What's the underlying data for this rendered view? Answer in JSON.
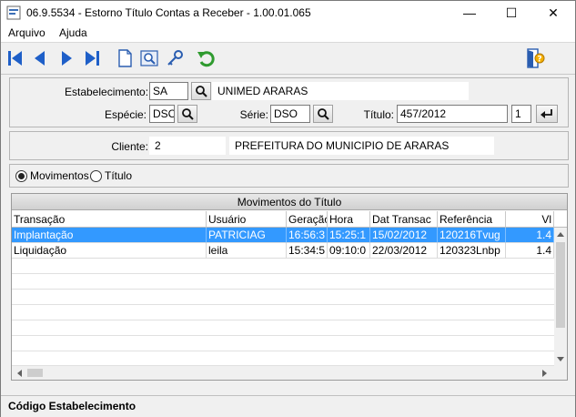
{
  "window": {
    "title": "06.9.5534 - Estorno Título Contas a Receber - 1.00.01.065",
    "minimize": "—",
    "maximize": "☐",
    "close": "✕"
  },
  "menu": [
    "Arquivo",
    "Ajuda"
  ],
  "toolbar": {
    "icons": [
      "first-record-icon",
      "previous-record-icon",
      "next-record-icon",
      "last-record-icon",
      "new-document-icon",
      "search-icon",
      "key-icon",
      "undo-icon",
      "exit-icon"
    ]
  },
  "form": {
    "estabelecimento_label": "Estabelecimento:",
    "estabelecimento_code": "SA",
    "estabelecimento_name": "UNIMED ARARAS",
    "especie_label": "Espécie:",
    "especie_value": "DSC",
    "serie_label": "Série:",
    "serie_value": "DSO",
    "titulo_label": "Título:",
    "titulo_value": "457/2012",
    "parcela_value": "1",
    "cliente_label": "Cliente:",
    "cliente_code": "2",
    "cliente_name": "PREFEITURA DO MUNICIPIO DE ARARAS"
  },
  "view_options": {
    "movimentos_label": "Movimentos",
    "titulo_label": "Título",
    "selected": "Movimentos"
  },
  "grid": {
    "caption": "Movimentos do Título",
    "columns": [
      "Transação",
      "Usuário",
      "Geração",
      "Hora",
      "Dat Transac",
      "Referência",
      "Vl"
    ],
    "rows": [
      [
        "Implantação",
        "PATRICIAG",
        "16:56:3",
        "15:25:1",
        "15/02/2012",
        "120216Tvug",
        "1.4"
      ],
      [
        "Liquidação",
        "leila",
        "15:34:5",
        "09:10:0",
        "22/03/2012",
        "120323Lnbp",
        "1.4"
      ]
    ],
    "selected_row": 0
  },
  "status_bar": {
    "text": "Código Estabelecimento"
  }
}
